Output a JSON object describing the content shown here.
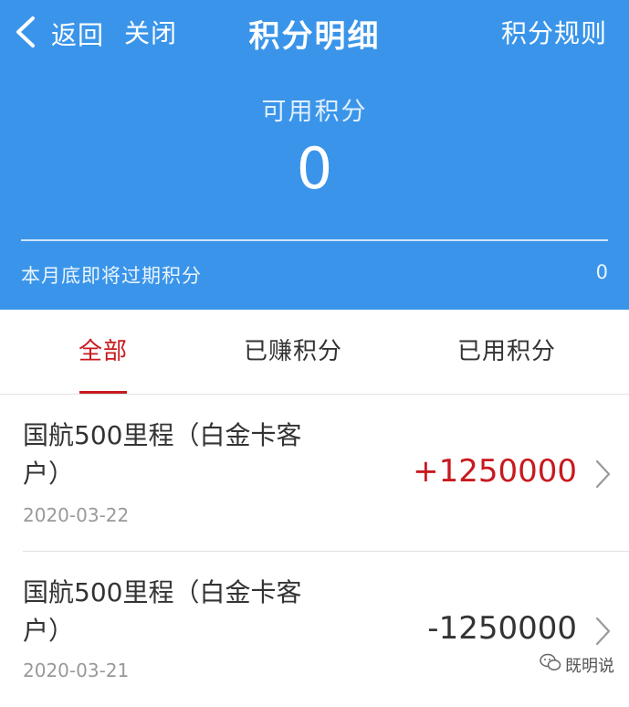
{
  "colors": {
    "header_bg": "#3a95ea",
    "active": "#c8191e",
    "earn": "#c8191e",
    "spend": "#333333"
  },
  "nav": {
    "back_label": "返回",
    "close_label": "关闭",
    "title": "积分明细",
    "rules_label": "积分规则"
  },
  "summary": {
    "available_label": "可用积分",
    "available_value": "0",
    "expiring_label": "本月底即将过期积分",
    "expiring_value": "0"
  },
  "tabs": [
    {
      "label": "全部",
      "active": true
    },
    {
      "label": "已赚积分"
    },
    {
      "label": "已用积分"
    }
  ],
  "records": [
    {
      "title": "国航500里程（白金卡客户）",
      "date": "2020-03-22",
      "amount": "+1250000",
      "type": "earn"
    },
    {
      "title": "国航500里程（白金卡客户）",
      "date": "2020-03-21",
      "amount": "-1250000",
      "type": "spend"
    }
  ],
  "watermark": {
    "icon": "wechat-icon",
    "text": "既明说"
  }
}
